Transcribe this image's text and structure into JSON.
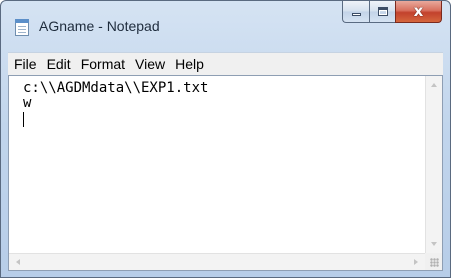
{
  "window": {
    "title": "AGname - Notepad",
    "app_icon": "notepad-icon"
  },
  "caption_buttons": {
    "minimize_icon": "minimize-icon",
    "maximize_icon": "maximize-icon",
    "close_icon": "close-icon",
    "close_glyph": "x",
    "close_color": "#c2412c"
  },
  "menubar": {
    "items": [
      {
        "label": "File"
      },
      {
        "label": "Edit"
      },
      {
        "label": "Format"
      },
      {
        "label": "View"
      },
      {
        "label": "Help"
      }
    ]
  },
  "editor": {
    "lines": [
      "c:\\\\AGDMdata\\\\EXP1.txt",
      "w"
    ]
  }
}
